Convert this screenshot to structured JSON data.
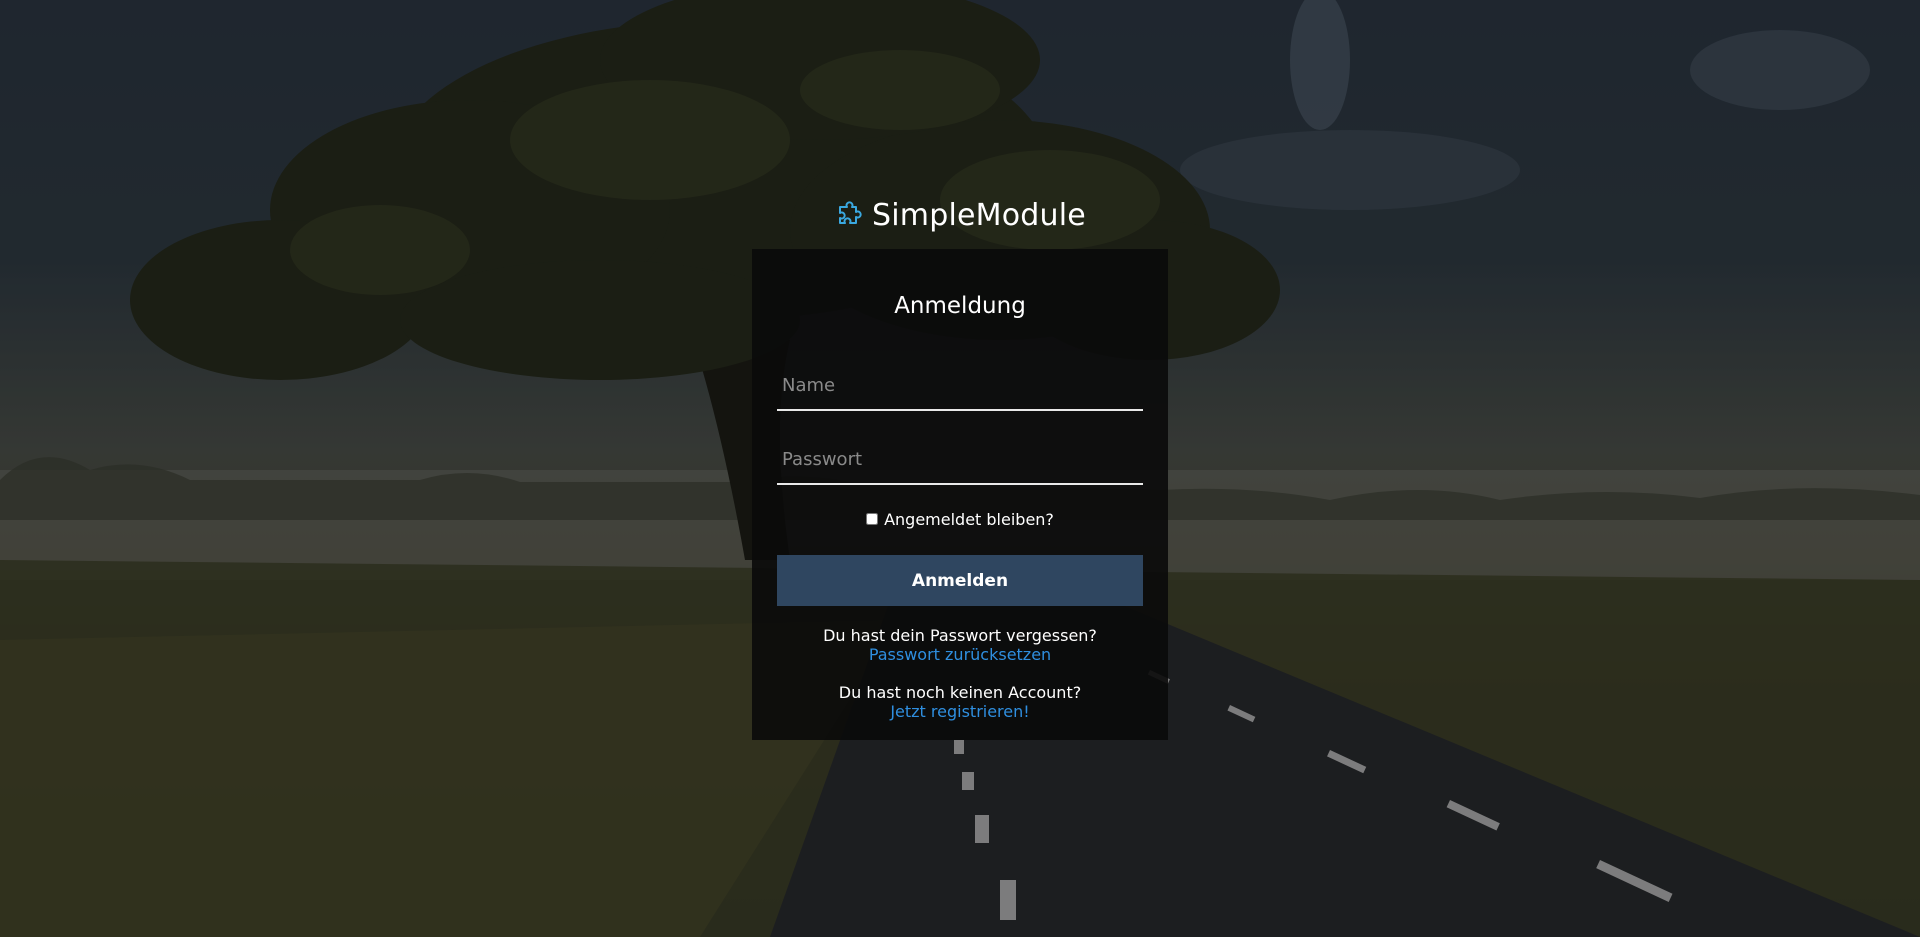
{
  "brand": {
    "name": "SimpleModule",
    "icon": "puzzle-piece-icon",
    "icon_color": "#3aa8e0"
  },
  "login": {
    "title": "Anmeldung",
    "name_placeholder": "Name",
    "password_placeholder": "Passwort",
    "remember_label": "Angemeldet bleiben?",
    "remember_checked": false,
    "submit_label": "Anmelden",
    "forgot_text": "Du hast dein Passwort vergessen?",
    "forgot_link": "Passwort zurücksetzen",
    "register_text": "Du hast noch keinen Account?",
    "register_link": "Jetzt registrieren!"
  },
  "colors": {
    "button": "#2f4660",
    "link": "#2f8fe0",
    "card": "rgba(10,10,10,0.9)"
  }
}
